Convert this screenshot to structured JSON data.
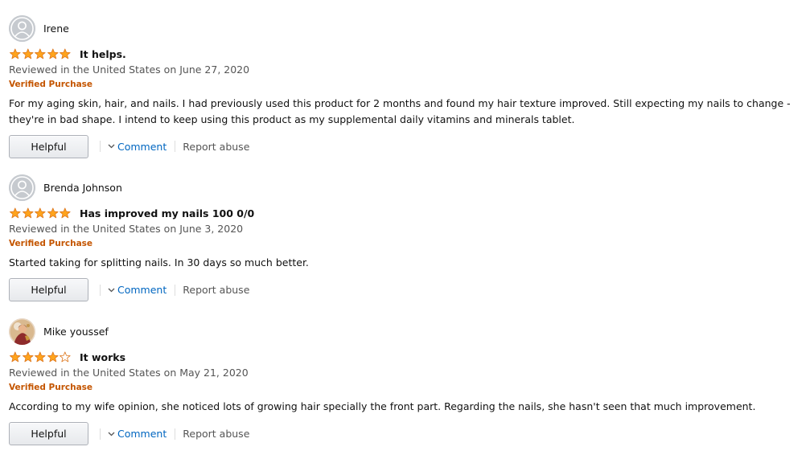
{
  "reviews": [
    {
      "author": "Irene",
      "avatar": "default-profile-icon",
      "rating": 5,
      "title": "It helps.",
      "date": "Reviewed in the United States on June 27, 2020",
      "badge": "Verified Purchase",
      "body": "For my aging skin, hair, and nails. I had previously used this product for 2 months and found my hair texture improved. Still expecting my nails to change - they're in bad shape. I intend to keep using this product as my supplemental daily vitamins and minerals tablet.",
      "helpful_label": "Helpful",
      "comment_label": "Comment",
      "report_label": "Report abuse"
    },
    {
      "author": "Brenda Johnson",
      "avatar": "default-profile-icon",
      "rating": 5,
      "title": "Has improved my nails 100 0/0",
      "date": "Reviewed in the United States on June 3, 2020",
      "badge": "Verified Purchase",
      "body": "Started taking for splitting nails. In 30 days so much better.",
      "helpful_label": "Helpful",
      "comment_label": "Comment",
      "report_label": "Report abuse"
    },
    {
      "author": "Mike youssef",
      "avatar": "photo-avatar",
      "rating": 4,
      "title": "It works",
      "date": "Reviewed in the United States on May 21, 2020",
      "badge": "Verified Purchase",
      "body": "According to my wife opinion, she noticed lots of growing hair specially the front part. Regarding the nails, she hasn't seen that much improvement.",
      "helpful_label": "Helpful",
      "comment_label": "Comment",
      "report_label": "Report abuse"
    }
  ],
  "colors": {
    "star_fill": "#ffa41c",
    "star_stroke": "#de7921",
    "verified": "#c45500",
    "link": "#0066c0",
    "muted": "#555555"
  }
}
